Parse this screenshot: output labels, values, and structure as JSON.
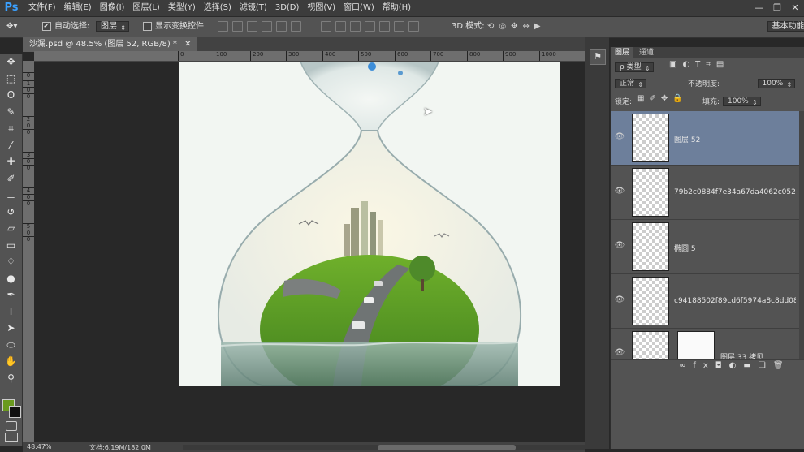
{
  "app": {
    "logo": "Ps"
  },
  "menu": [
    "文件(F)",
    "编辑(E)",
    "图像(I)",
    "图层(L)",
    "类型(Y)",
    "选择(S)",
    "滤镜(T)",
    "3D(D)",
    "视图(V)",
    "窗口(W)",
    "帮助(H)"
  ],
  "window_controls": [
    "—",
    "❐",
    "✕"
  ],
  "options": {
    "auto_select_label": "自动选择:",
    "auto_select_value": "图层",
    "show_transform_label": "显示变换控件",
    "mode_3d_label": "3D 模式:",
    "workspace_value": "基本功能"
  },
  "document_tab": {
    "title": "沙漏.psd @ 48.5% (图层 52, RGB/8) *",
    "close": "✕"
  },
  "ruler_h": [
    "0",
    "100",
    "200",
    "300",
    "400",
    "500",
    "600",
    "700",
    "800",
    "900",
    "1000",
    "1100",
    "1200",
    "1300",
    "1400"
  ],
  "ruler_v": [
    "0",
    "1",
    "0",
    "0",
    "2",
    "0",
    "0",
    "3",
    "0",
    "0",
    "4",
    "0",
    "0",
    "5",
    "0",
    "0"
  ],
  "layers_panel": {
    "tabs": [
      "图层",
      "通道"
    ],
    "filter_label": "ρ 类型",
    "blend_mode": "正常",
    "opacity_label": "不透明度:",
    "opacity_value": "100%",
    "lock_label": "锁定:",
    "fill_label": "填充:",
    "fill_value": "100%",
    "layers": [
      {
        "name": "图层 52",
        "selected": true
      },
      {
        "name": "79b2c0884f7e34a67da4062c052b...",
        "selected": false
      },
      {
        "name": "椭圆 5",
        "selected": false
      },
      {
        "name": "c94188502f89cd6f5974a8c8dd08...",
        "selected": false
      },
      {
        "name": "图层 33 拷贝",
        "selected": false
      }
    ],
    "footer_icons": [
      "link-icon",
      "fx-icon",
      "mask-icon",
      "adjustment-icon",
      "group-icon",
      "new-layer-icon",
      "trash-icon"
    ]
  },
  "status": {
    "zoom": "48.47%",
    "doc_info": "文档:6.19M/182.0M"
  },
  "colors": {
    "foreground": "#6a9a1f",
    "background": "#111111",
    "selection": "#6d7f9b"
  }
}
